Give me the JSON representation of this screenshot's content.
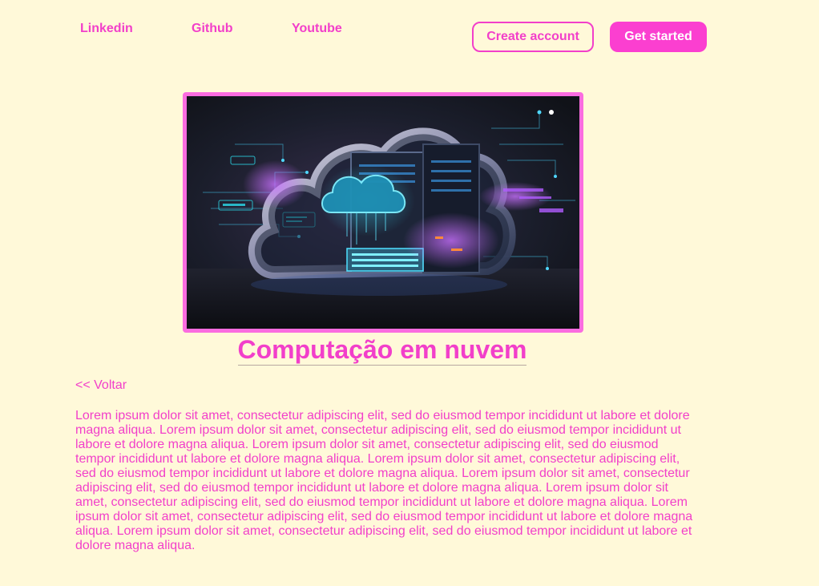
{
  "nav": {
    "links": [
      "Linkedin",
      "Github",
      "Youtube"
    ],
    "create_account": "Create account",
    "get_started": "Get started"
  },
  "hero": {
    "image_icon": "cloud-server-illustration"
  },
  "article": {
    "title": "Computação em nuvem",
    "back_link": "<< Voltar",
    "body": "Lorem ipsum dolor sit amet, consectetur adipiscing elit, sed do eiusmod tempor incididunt ut labore et dolore magna aliqua. Lorem ipsum dolor sit amet, consectetur adipiscing elit, sed do eiusmod tempor incididunt ut labore et dolore magna aliqua. Lorem ipsum dolor sit amet, consectetur adipiscing elit, sed do eiusmod tempor incididunt ut labore et dolore magna aliqua. Lorem ipsum dolor sit amet, consectetur adipiscing elit, sed do eiusmod tempor incididunt ut labore et dolore magna aliqua. Lorem ipsum dolor sit amet, consectetur adipiscing elit, sed do eiusmod tempor incididunt ut labore et dolore magna aliqua. Lorem ipsum dolor sit amet, consectetur adipiscing elit, sed do eiusmod tempor incididunt ut labore et dolore magna aliqua. Lorem ipsum dolor sit amet, consectetur adipiscing elit, sed do eiusmod tempor incididunt ut labore et dolore magna aliqua. Lorem ipsum dolor sit amet, consectetur adipiscing elit, sed do eiusmod tempor incididunt ut labore et dolore magna aliqua."
  },
  "colors": {
    "background": "#fff9d9",
    "accent": "#f23fca",
    "button_fill": "#fb3fd0",
    "image_border": "#fb6ce0"
  }
}
